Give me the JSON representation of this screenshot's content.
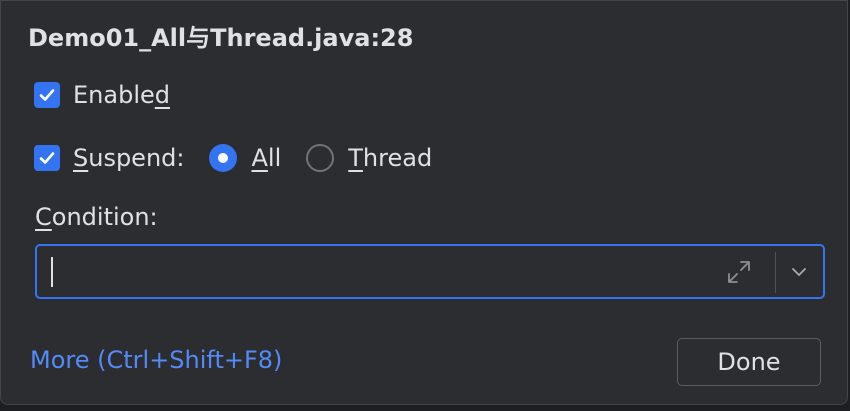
{
  "dialog": {
    "title": "Demo01_All与Thread.java:28"
  },
  "enabled": {
    "label_pre": "Enable",
    "label_mn": "d",
    "label_post": "",
    "checked": true
  },
  "suspend": {
    "label_pre": "",
    "label_mn": "S",
    "label_post": "uspend:",
    "checked": true,
    "options": [
      {
        "label_mn": "A",
        "label_rest": "ll",
        "selected": true
      },
      {
        "label_mn": "T",
        "label_rest": "hread",
        "selected": false
      }
    ]
  },
  "condition": {
    "label_mn": "C",
    "label_rest": "ondition:",
    "value": "",
    "expand_icon": "expand-icon",
    "dropdown_icon": "chevron-down-icon"
  },
  "footer": {
    "more_link": "More (Ctrl+Shift+F8)",
    "done_label": "Done"
  },
  "colors": {
    "accent": "#3574f0",
    "link": "#548af7",
    "background": "#2b2d30"
  }
}
